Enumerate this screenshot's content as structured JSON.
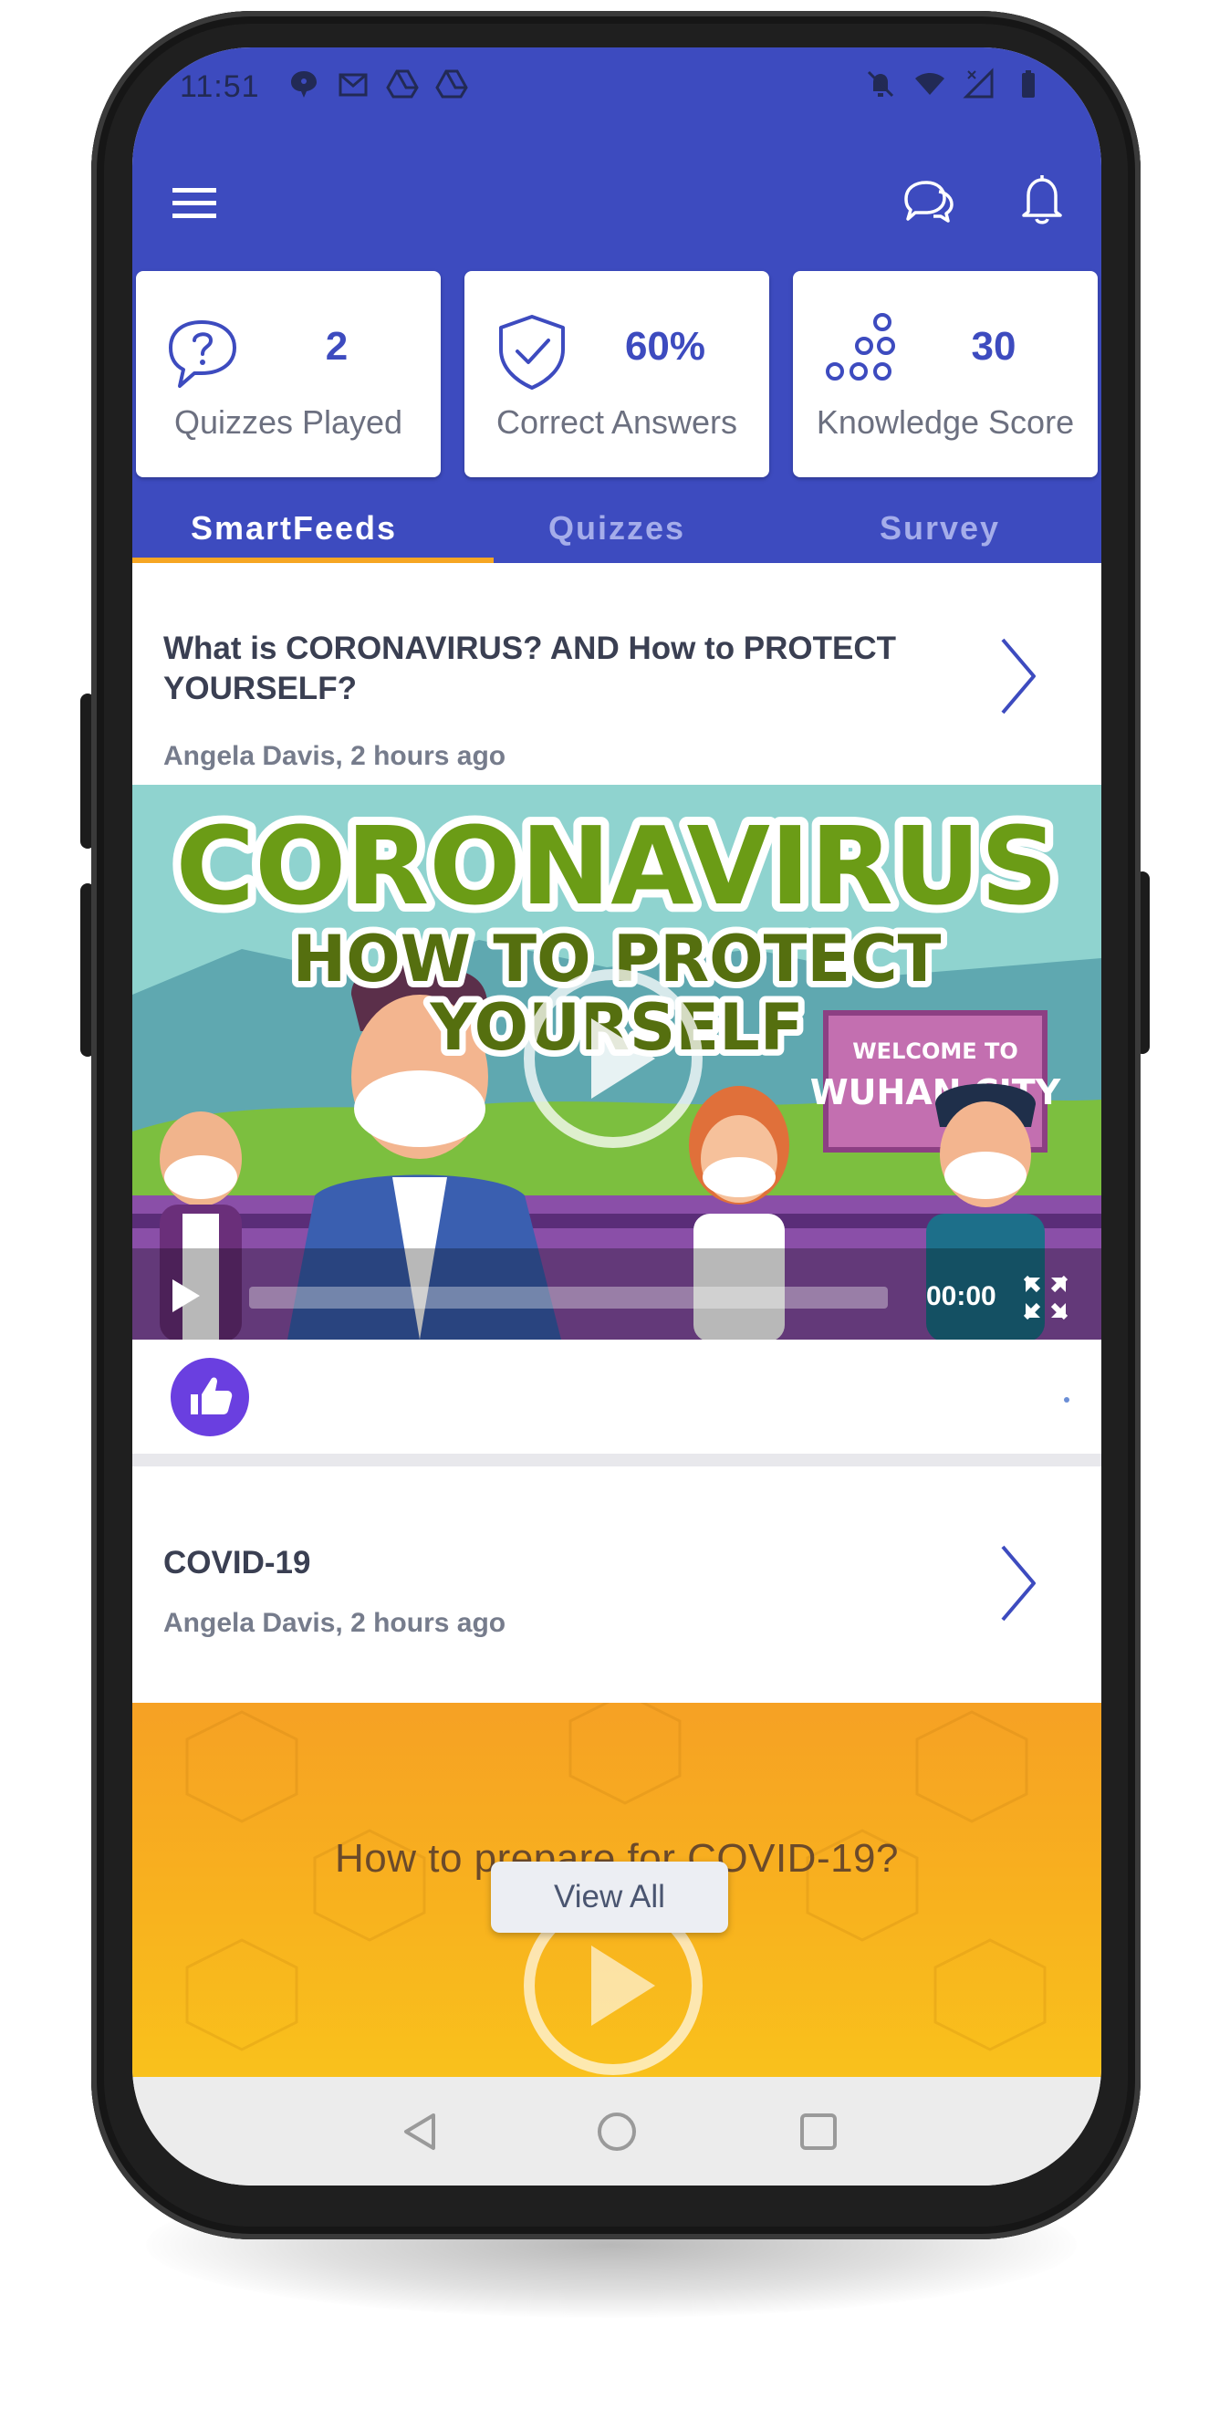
{
  "status_bar": {
    "time": "11:51",
    "left_icons": [
      "chat-notification-icon",
      "gmail-icon",
      "drive-icon",
      "drive-icon"
    ],
    "right_icons": [
      "bell-off-icon",
      "wifi-icon",
      "no-signal-icon",
      "battery-icon"
    ]
  },
  "app_bar": {
    "icons": [
      "menu-icon",
      "chat-bubbles-icon",
      "bell-icon"
    ]
  },
  "stats": [
    {
      "value": "2",
      "label": "Quizzes Played",
      "icon": "question-bubble-icon"
    },
    {
      "value": "60%",
      "label": "Correct Answers",
      "icon": "shield-check-icon"
    },
    {
      "value": "30",
      "label": "Knowledge Score",
      "icon": "circles-pyramid-icon"
    }
  ],
  "tabs": [
    {
      "label": "SmartFeeds",
      "active": true
    },
    {
      "label": "Quizzes",
      "active": false
    },
    {
      "label": "Survey",
      "active": false
    }
  ],
  "feed": [
    {
      "title": "What is CORONAVIRUS? AND How to PROTECT YOURSELF?",
      "meta": "Angela Davis, 2 hours ago"
    },
    {
      "title": "COVID-19",
      "meta": "Angela Davis, 2 hours ago"
    }
  ],
  "video": {
    "headline": "CORONAVIRUS",
    "subheadline_1": "HOW TO PROTECT",
    "subheadline_2": "YOURSELF",
    "sign_line_1": "WELCOME TO",
    "sign_line_2": "WUHAN CITY",
    "time": "00:00",
    "progress": 0
  },
  "second_media": {
    "title": "How to prepare for COVID-19?"
  },
  "view_all_label": "View All",
  "colors": {
    "primary": "#3d4bbf",
    "tab_indicator": "#f6a623",
    "like": "#6a3fe0"
  }
}
